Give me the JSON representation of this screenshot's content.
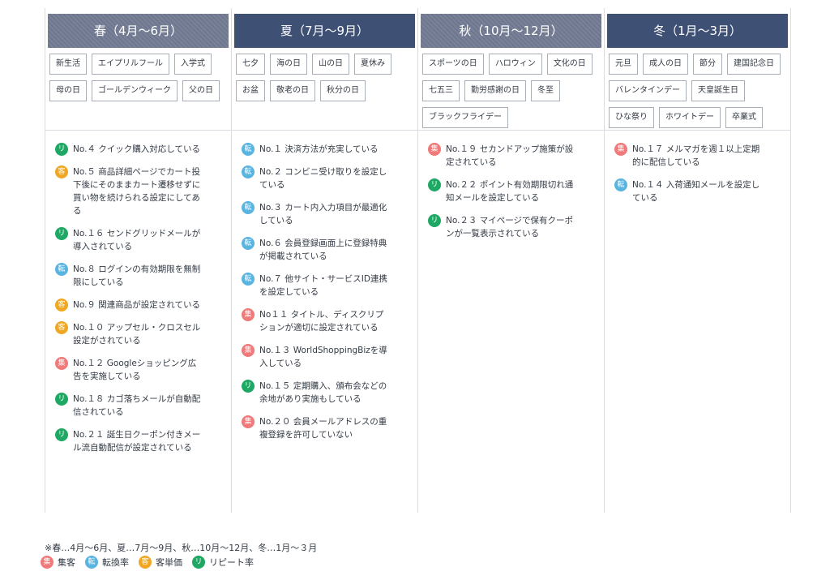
{
  "columns": [
    {
      "title": "春（4月〜6月）",
      "head_style": "hatched",
      "tags": [
        "新生活",
        "エイプリルフール",
        "入学式",
        "母の日",
        "ゴールデンウィーク",
        "父の日"
      ],
      "items": [
        {
          "badge": "リ",
          "type": "ri",
          "text": "No.４ クイック購入対応している"
        },
        {
          "badge": "客",
          "type": "kyaku",
          "text": "No.５ 商品詳細ページでカート投下後にそのままカート遷移せずに買い物を続けられる設定にしてある"
        },
        {
          "badge": "リ",
          "type": "ri",
          "text": "No.１６ センドグリッドメールが導入されている"
        },
        {
          "badge": "転",
          "type": "ten",
          "text": "No.８ ログインの有効期限を無制限にしている"
        },
        {
          "badge": "客",
          "type": "kyaku",
          "text": "No.９ 関連商品が設定されている"
        },
        {
          "badge": "客",
          "type": "kyaku",
          "text": "No.１０ アップセル・クロスセル設定がされている"
        },
        {
          "badge": "集",
          "type": "shu",
          "text": "No.１２ Googleショッピング広告を実施している"
        },
        {
          "badge": "リ",
          "type": "ri",
          "text": "No.１８ カゴ落ちメールが自動配信されている"
        },
        {
          "badge": "リ",
          "type": "ri",
          "text": "No.２１ 誕生日クーポン付きメール流自動配信が設定されている"
        }
      ]
    },
    {
      "title": "夏（7月〜9月）",
      "head_style": "solid",
      "tags": [
        "七夕",
        "海の日",
        "山の日",
        "夏休み",
        "お盆",
        "敬老の日",
        "秋分の日"
      ],
      "items": [
        {
          "badge": "転",
          "type": "ten",
          "text": "No.１ 決済方法が充実している"
        },
        {
          "badge": "転",
          "type": "ten",
          "text": "No.２ コンビニ受け取りを設定している"
        },
        {
          "badge": "転",
          "type": "ten",
          "text": "No.３ カート内入力項目が最適化している"
        },
        {
          "badge": "転",
          "type": "ten",
          "text": "No.６ 会員登録画面上に登録特典が掲載されている"
        },
        {
          "badge": "転",
          "type": "ten",
          "text": "No.７ 他サイト・サービスID連携を設定している"
        },
        {
          "badge": "集",
          "type": "shu",
          "text": "No１１ タイトル、ディスクリプションが適切に設定されている"
        },
        {
          "badge": "集",
          "type": "shu",
          "text": "No.１３ WorldShoppingBizを導入している"
        },
        {
          "badge": "リ",
          "type": "ri",
          "text": "No.１５ 定期購入、頒布会などの余地があり実施もしている"
        },
        {
          "badge": "集",
          "type": "shu",
          "text": "No.２０ 会員メールアドレスの重複登録を許可していない"
        }
      ]
    },
    {
      "title": "秋（10月〜12月）",
      "head_style": "hatched",
      "tags": [
        "スポーツの日",
        "ハロウィン",
        "文化の日",
        "七五三",
        "勤労感謝の日",
        "冬至",
        "ブラックフライデー"
      ],
      "items": [
        {
          "badge": "集",
          "type": "shu",
          "text": "No.１９ セカンドアップ施策が設定されている"
        },
        {
          "badge": "リ",
          "type": "ri",
          "text": "No.２２ ポイント有効期限切れ通知メールを設定している"
        },
        {
          "badge": "リ",
          "type": "ri",
          "text": "No.２３ マイページで保有クーポンが一覧表示されている"
        }
      ]
    },
    {
      "title": "冬（1月〜3月）",
      "head_style": "solid",
      "tags": [
        "元旦",
        "成人の日",
        "節分",
        "建国記念日",
        "バレンタインデー",
        "天皇誕生日",
        "ひな祭り",
        "ホワイトデー",
        "卒業式"
      ],
      "items": [
        {
          "badge": "集",
          "type": "shu",
          "text": "No.１７ メルマガを週１以上定期的に配信している"
        },
        {
          "badge": "転",
          "type": "ten",
          "text": "No.１４ 入荷通知メールを設定している"
        }
      ]
    }
  ],
  "footer_note": "※春…4月〜6月、夏…7月〜9月、秋…10月〜12月、冬…1月〜３月",
  "legend": [
    {
      "badge": "集",
      "type": "shu",
      "label": "集客"
    },
    {
      "badge": "転",
      "type": "ten",
      "label": "転換率"
    },
    {
      "badge": "客",
      "type": "kyaku",
      "label": "客単価"
    },
    {
      "badge": "リ",
      "type": "ri",
      "label": "リピート率"
    }
  ],
  "colors": {
    "shu": "#f07a7a",
    "ten": "#5ab4e0",
    "kyaku": "#f0a823",
    "ri": "#1fa864",
    "header_solid": "#3f5075",
    "header_hatched": "#7a8298"
  }
}
